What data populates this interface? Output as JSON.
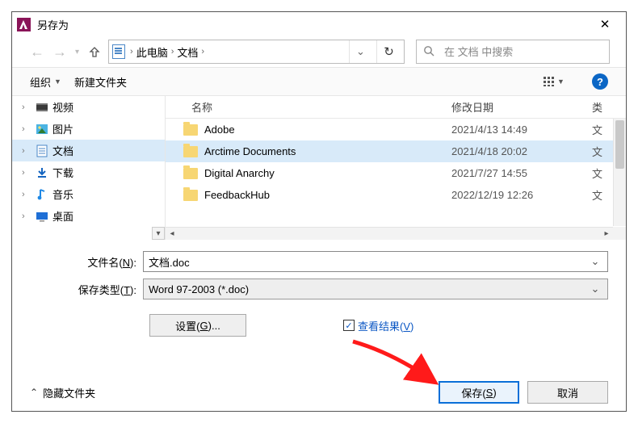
{
  "title": "另存为",
  "breadcrumb": {
    "root": "此电脑",
    "folder": "文档",
    "sep": "›"
  },
  "search": {
    "placeholder": "在 文档 中搜索"
  },
  "toolbar": {
    "organize": "组织",
    "new_folder": "新建文件夹"
  },
  "tree": [
    {
      "label": "视频",
      "icon": "video"
    },
    {
      "label": "图片",
      "icon": "picture"
    },
    {
      "label": "文档",
      "icon": "document",
      "selected": true
    },
    {
      "label": "下载",
      "icon": "download"
    },
    {
      "label": "音乐",
      "icon": "music"
    },
    {
      "label": "桌面",
      "icon": "desktop"
    }
  ],
  "columns": {
    "name": "名称",
    "date": "修改日期",
    "type": "类"
  },
  "rows": [
    {
      "name": "Adobe",
      "date": "2021/4/13 14:49",
      "type": "文"
    },
    {
      "name": "Arctime Documents",
      "date": "2021/4/18 20:02",
      "type": "文",
      "selected": true
    },
    {
      "name": "Digital Anarchy",
      "date": "2021/7/27 14:55",
      "type": "文"
    },
    {
      "name": "FeedbackHub",
      "date": "2022/12/19 12:26",
      "type": "文"
    }
  ],
  "filename": {
    "label_pre": "文件名(",
    "label_u": "N",
    "label_post": "):",
    "value": "文档.doc"
  },
  "savetype": {
    "label_pre": "保存类型(",
    "label_u": "T",
    "label_post": "):",
    "value": "Word 97-2003 (*.doc)"
  },
  "settings": {
    "label_pre": "设置(",
    "label_u": "G",
    "label_post": ")..."
  },
  "viewresult": {
    "label_pre": "查看结果(",
    "label_u": "V",
    "label_post": ")"
  },
  "hide_folders": "隐藏文件夹",
  "save": {
    "label_pre": "保存(",
    "label_u": "S",
    "label_post": ")"
  },
  "cancel": "取消"
}
